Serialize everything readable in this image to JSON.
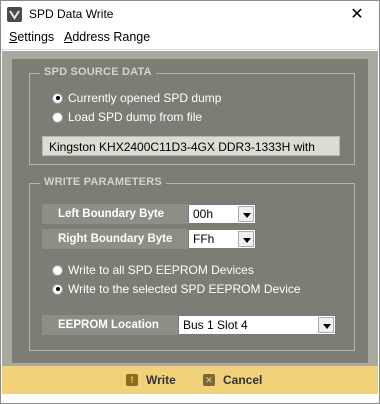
{
  "window": {
    "title": "SPD Data Write",
    "close_glyph": "✕"
  },
  "menu": {
    "settings_first": "S",
    "settings_rest": "ettings",
    "address_first": "A",
    "address_rest": "ddress Range"
  },
  "source": {
    "group_title": "SPD SOURCE DATA",
    "opt_current": "Currently opened SPD dump",
    "opt_file": "Load SPD dump from file",
    "selected": "current",
    "dump_name": "Kingston KHX2400C11D3-4GX DDR3-1333H with"
  },
  "write_params": {
    "group_title": "WRITE PARAMETERS",
    "left_label": "Left Boundary Byte",
    "left_value": "00h",
    "right_label": "Right Boundary Byte",
    "right_value": "FFh",
    "opt_all": "Write to all SPD EEPROM Devices",
    "opt_selected": "Write to the selected SPD EEPROM Device",
    "selected": "selected",
    "location_label": "EEPROM Location",
    "location_value": "Bus 1 Slot 4"
  },
  "actions": {
    "write_label": "Write",
    "cancel_label": "Cancel",
    "write_icon": "!",
    "cancel_icon": "✕"
  },
  "icons": {
    "app": "app-logo-icon",
    "close": "close-icon",
    "dropdown": "chevron-down-icon"
  },
  "colors": {
    "panel": "#7d7d75",
    "frame": "#a9a9a0",
    "bottom_bar": "#f1d27a",
    "readonly": "#dcdcd4"
  }
}
